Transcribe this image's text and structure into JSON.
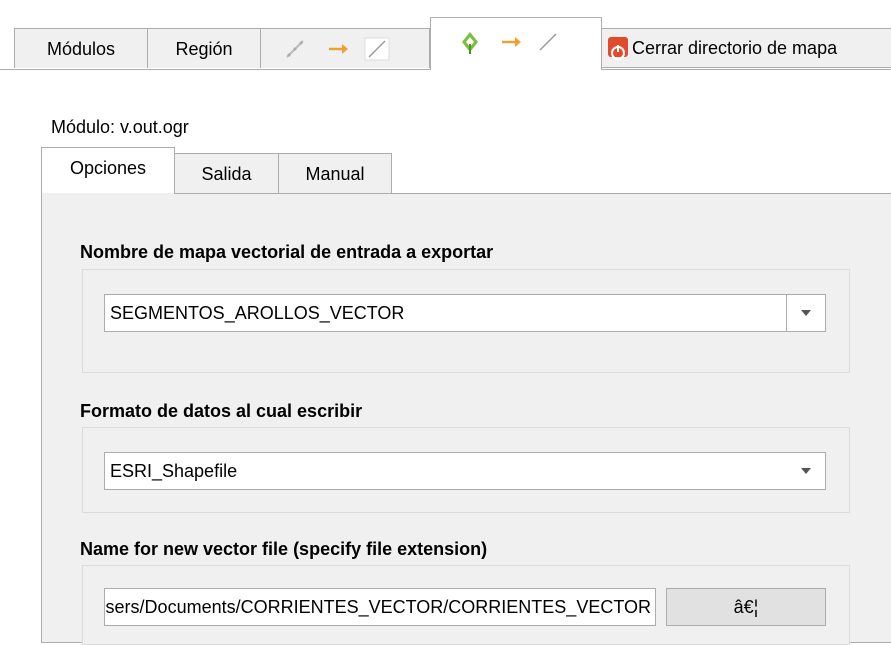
{
  "top_tabs": {
    "modules": "Módulos",
    "region": "Región",
    "close_mapset": "Cerrar directorio de mapa"
  },
  "module": {
    "label": "Módulo: v.out.ogr"
  },
  "inner_tabs": [
    "Opciones",
    "Salida",
    "Manual"
  ],
  "fields": {
    "input_title": "Nombre de mapa vectorial de entrada a exportar",
    "input_value": "SEGMENTOS_AROLLOS_VECTOR",
    "format_title": "Formato de datos al cual escribir",
    "format_value": "ESRI_Shapefile",
    "output_title": "Name for new vector file (specify file extension)",
    "output_value": "C:/Users/Documents/CORRIENTES_VECTOR/CORRIENTES_VECTOR",
    "browse_label": "â€¦"
  },
  "colors": {
    "tab_bg": "#f0f0f0",
    "border": "#adadad",
    "close_icon": "#e24a2c",
    "arrow_orange": "#f0a030"
  },
  "icons": [
    "vector-line-icon",
    "arrow-right-icon",
    "line-icon",
    "grass-icon",
    "power-icon",
    "combo-arrow-icon"
  ]
}
